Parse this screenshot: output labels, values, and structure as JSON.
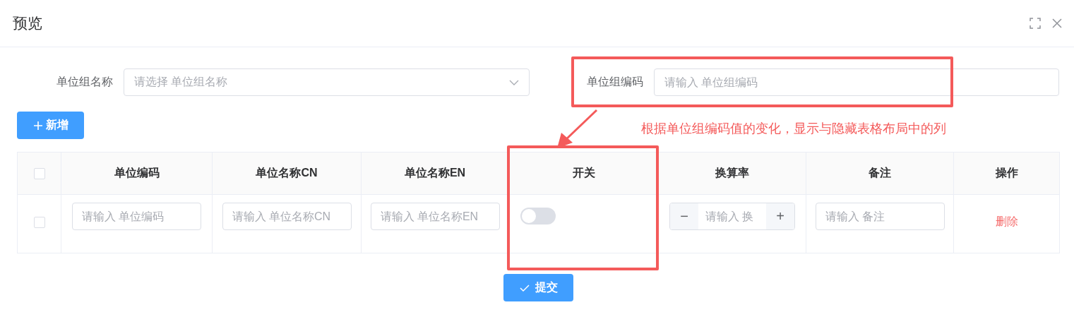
{
  "dialog": {
    "title": "预览"
  },
  "form": {
    "fields": [
      {
        "label": "单位组名称",
        "placeholder": "请选择 单位组名称",
        "kind": "select"
      },
      {
        "label": "单位组编码",
        "placeholder": "请输入 单位组编码",
        "kind": "input"
      }
    ]
  },
  "add_button": {
    "label": "新增"
  },
  "annotation": {
    "text": "根据单位组编码值的变化，显示与隐藏表格布局中的列"
  },
  "table": {
    "select_all": {
      "checked": false
    },
    "columns": [
      "单位编码",
      "单位名称CN",
      "单位名称EN",
      "开关",
      "换算率",
      "备注",
      "操作"
    ],
    "rows": [
      {
        "checked": false,
        "code_placeholder": "请输入 单位编码",
        "name_cn_placeholder": "请输入 单位名称CN",
        "name_en_placeholder": "请输入 单位名称EN",
        "switch_on": false,
        "rate_placeholder": "请输入 换",
        "rate_minus": "−",
        "rate_plus": "+",
        "note_placeholder": "请输入 备注",
        "action": "删除"
      }
    ]
  },
  "submit_button": {
    "label": "提交"
  }
}
